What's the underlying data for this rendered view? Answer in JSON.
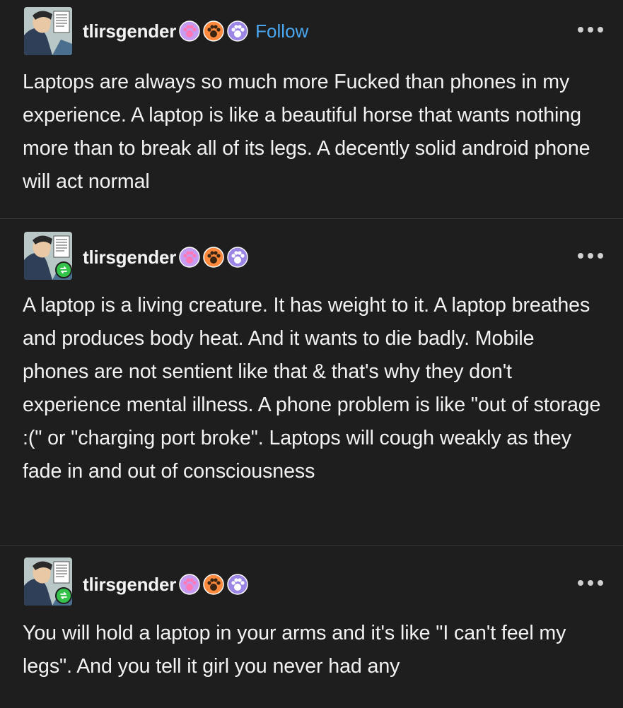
{
  "colors": {
    "background": "#1e1e1f",
    "text": "#f2f2f2",
    "follow": "#4aa6ef",
    "reblog_badge": "#35c24a",
    "divider": "#3a3a3c"
  },
  "posts": [
    {
      "username": "tlirsgender",
      "follow_label": "Follow",
      "more_icon": "ellipsis-icon",
      "reblogged": false,
      "text": "Laptops are always so much more Fucked than phones in my experience. A laptop is like a beautiful horse that wants nothing more than to break all of its legs. A decently solid android phone will act normal"
    },
    {
      "username": "tlirsgender",
      "more_icon": "ellipsis-icon",
      "reblogged": true,
      "text": "A laptop is a living creature. It has weight to it. A laptop breathes and produces body heat. And it wants to die badly. Mobile phones are not sentient like that & that's why they don't experience mental illness. A phone problem is like \"out of storage :(\" or \"charging port broke\". Laptops will cough weakly as they fade in and out of consciousness"
    },
    {
      "username": "tlirsgender",
      "more_icon": "ellipsis-icon",
      "reblogged": true,
      "text": "You will hold a laptop in your arms and it's like \"I can't feel my legs\". And you tell it girl you never had any"
    }
  ]
}
